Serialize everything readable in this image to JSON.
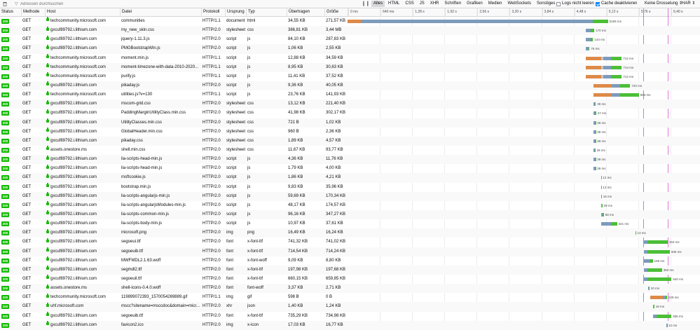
{
  "toolbar": {
    "filter_placeholder": "Adressen durchsuchen",
    "pause_glyph": "❙❙",
    "types": [
      "Alles",
      "HTML",
      "CSS",
      "JS",
      "XHR",
      "Schriften",
      "Grafiken",
      "Medien",
      "WebSockets",
      "Sonstiges"
    ],
    "active_type": "Alles",
    "persist_logs_label": "Logs nicht leeren",
    "persist_logs_checked": false,
    "disable_cache_label": "Cache deaktivieren",
    "disable_cache_checked": true,
    "throttle_label": "Keine Drosselung ⇕",
    "har_label": "HAR ⇕"
  },
  "columns": {
    "status": "Status",
    "method": "Methode",
    "host": "Host",
    "file": "Datei",
    "protocol": "Protokoll",
    "cause": "Ursprung",
    "type": "Typ",
    "transferred": "Übertragen",
    "size": "Größe"
  },
  "timeline_ticks": [
    "0 ms",
    "640 ms",
    "1,28 s",
    "1,92 s",
    "2,56 s",
    "3,20 s",
    "3,84 s",
    "4,48 s",
    "5,12 s",
    "5,76 s",
    "6,40 s"
  ],
  "timeline_max_ms": 6984,
  "markers": {
    "dom_content_loaded_ms": 5860,
    "load_ms": 6340
  },
  "colors": {
    "blocked": "#dd8a48",
    "connect": "#c4c4c7",
    "wait": "#7d9bbb",
    "receive": "#4bbf36",
    "status_ok": "#12bc00"
  },
  "requests": [
    {
      "status": "200",
      "method": "GET",
      "host": "techcommunity.microsoft.com",
      "file": "communities",
      "protocol": "HTTP/1.1",
      "cause": "document",
      "type": "html",
      "transferred": "34,55 KB",
      "size": "271,57 KB",
      "start": 0,
      "blocked": 260,
      "connect": 0,
      "wait": 4600,
      "recv": 300,
      "label": "5156 ms"
    },
    {
      "status": "200",
      "method": "GET",
      "host": "gxcuf89792.i.lithium.com",
      "file": "my_new_skin.css",
      "protocol": "HTTP/2.0",
      "cause": "stylesheet",
      "type": "css",
      "transferred": "386,81 KB",
      "size": "3,44 MB",
      "start": 4720,
      "blocked": 0,
      "connect": 0,
      "wait": 100,
      "recv": 70,
      "label": "170 ms"
    },
    {
      "status": "200",
      "method": "GET",
      "host": "gxcuf89792.i.lithium.com",
      "file": "jquery-1.11.3.js",
      "protocol": "HTTP/2.0",
      "cause": "script",
      "type": "js",
      "transferred": "84,10 KB",
      "size": "287,83 KB",
      "start": 4720,
      "blocked": 0,
      "connect": 0,
      "wait": 100,
      "recv": 44,
      "label": "144 ms"
    },
    {
      "status": "200",
      "method": "GET",
      "host": "gxcuf89792.i.lithium.com",
      "file": "PMGBootstrapWin.js",
      "protocol": "HTTP/2.0",
      "cause": "script",
      "type": "js",
      "transferred": "1,06 KB",
      "size": "2,55 KB",
      "start": 4720,
      "blocked": 0,
      "connect": 0,
      "wait": 60,
      "recv": 16,
      "label": "76 ms"
    },
    {
      "status": "200",
      "method": "GET",
      "host": "techcommunity.microsoft.com",
      "file": "moment.min.js",
      "protocol": "HTTP/1.1",
      "cause": "script",
      "type": "js",
      "transferred": "12,88 KB",
      "size": "34,59 KB",
      "start": 4720,
      "blocked": 300,
      "connect": 50,
      "wait": 150,
      "recv": 212,
      "label": "712 ms"
    },
    {
      "status": "200",
      "method": "GET",
      "host": "techcommunity.microsoft.com",
      "file": "moment-timezone-with-data-2010-2020...",
      "protocol": "HTTP/1.1",
      "cause": "script",
      "type": "js",
      "transferred": "8,95 KB",
      "size": "30,63 KB",
      "start": 4720,
      "blocked": 300,
      "connect": 50,
      "wait": 150,
      "recv": 214,
      "label": "714 ms"
    },
    {
      "status": "200",
      "method": "GET",
      "host": "techcommunity.microsoft.com",
      "file": "purify.js",
      "protocol": "HTTP/1.1",
      "cause": "script",
      "type": "js",
      "transferred": "11,41 KB",
      "size": "37,52 KB",
      "start": 4720,
      "blocked": 300,
      "connect": 50,
      "wait": 150,
      "recv": 213,
      "label": "713 ms"
    },
    {
      "status": "200",
      "method": "GET",
      "host": "gxcuf89792.i.lithium.com",
      "file": "pikaday.js",
      "protocol": "HTTP/2.0",
      "cause": "script",
      "type": "js",
      "transferred": "9,36 KB",
      "size": "40,05 KB",
      "start": 4880,
      "blocked": 360,
      "connect": 0,
      "wait": 160,
      "recv": 200,
      "label": "720 ms"
    },
    {
      "status": "200",
      "method": "GET",
      "host": "techcommunity.microsoft.com",
      "file": "utilities.js?v=130",
      "protocol": "HTTP/1.1",
      "cause": "script",
      "type": "js",
      "transferred": "23,76 KB",
      "size": "141,93 KB",
      "start": 4880,
      "blocked": 360,
      "connect": 0,
      "wait": 160,
      "recv": 373,
      "label": "893 ms"
    },
    {
      "status": "200",
      "method": "GET",
      "host": "gxcuf89792.i.lithium.com",
      "file": "mscom-grid.css",
      "protocol": "HTTP/2.0",
      "cause": "stylesheet",
      "type": "css",
      "transferred": "13,12 KB",
      "size": "221,40 KB",
      "start": 4880,
      "blocked": 0,
      "connect": 0,
      "wait": 20,
      "recv": 19,
      "label": "39 ms"
    },
    {
      "status": "200",
      "method": "GET",
      "host": "gxcuf89792.i.lithium.com",
      "file": "PaddingMarginUtilityClass.min.css",
      "protocol": "HTTP/2.0",
      "cause": "stylesheet",
      "type": "css",
      "transferred": "41,98 KB",
      "size": "302,17 KB",
      "start": 4880,
      "blocked": 0,
      "connect": 0,
      "wait": 25,
      "recv": 22,
      "label": "47 ms"
    },
    {
      "status": "200",
      "method": "GET",
      "host": "gxcuf89792.i.lithium.com",
      "file": "UtilityClasses.min.css",
      "protocol": "HTTP/2.0",
      "cause": "stylesheet",
      "type": "css",
      "transferred": "721 B",
      "size": "1,02 KB",
      "start": 4880,
      "blocked": 0,
      "connect": 0,
      "wait": 30,
      "recv": 9,
      "label": "39 ms"
    },
    {
      "status": "200",
      "method": "GET",
      "host": "gxcuf89792.i.lithium.com",
      "file": "GlobalHeader.min.css",
      "protocol": "HTTP/2.0",
      "cause": "stylesheet",
      "type": "css",
      "transferred": "960 B",
      "size": "2,36 KB",
      "start": 4880,
      "blocked": 0,
      "connect": 0,
      "wait": 30,
      "recv": 9,
      "label": "39 ms"
    },
    {
      "status": "200",
      "method": "GET",
      "host": "gxcuf89792.i.lithium.com",
      "file": "pikaday.css",
      "protocol": "HTTP/2.0",
      "cause": "stylesheet",
      "type": "css",
      "transferred": "1,89 KB",
      "size": "4,57 KB",
      "start": 4880,
      "blocked": 0,
      "connect": 0,
      "wait": 30,
      "recv": 9,
      "label": "39 ms"
    },
    {
      "status": "200",
      "method": "GET",
      "host": "assets.onestore.ms",
      "file": "shell.min.css",
      "protocol": "HTTP/2.0",
      "cause": "stylesheet",
      "type": "css",
      "transferred": "11,67 KB",
      "size": "93,77 KB",
      "start": 4880,
      "blocked": 0,
      "connect": 0,
      "wait": 20,
      "recv": 8,
      "label": "28 ms"
    },
    {
      "status": "200",
      "method": "GET",
      "host": "gxcuf89792.i.lithium.com",
      "file": "lia-scripts-head-min.js",
      "protocol": "HTTP/2.0",
      "cause": "script",
      "type": "js",
      "transferred": "4,36 KB",
      "size": "11,76 KB",
      "start": 4880,
      "blocked": 0,
      "connect": 0,
      "wait": 30,
      "recv": 9,
      "label": "39 ms"
    },
    {
      "status": "200",
      "method": "GET",
      "host": "gxcuf89792.i.lithium.com",
      "file": "lia-scripts-head-min.js",
      "protocol": "HTTP/2.0",
      "cause": "script",
      "type": "js",
      "transferred": "1,79 KB",
      "size": "4,00 KB",
      "start": 4880,
      "blocked": 0,
      "connect": 0,
      "wait": 30,
      "recv": 9,
      "label": "39 ms"
    },
    {
      "status": "200",
      "method": "GET",
      "host": "gxcuf89792.i.lithium.com",
      "file": "msftcookie.js",
      "protocol": "HTTP/2.0",
      "cause": "script",
      "type": "js",
      "transferred": "1,86 KB",
      "size": "4,21 KB",
      "start": 5020,
      "blocked": 0,
      "connect": 0,
      "wait": 8,
      "recv": 4,
      "label": "12 ms"
    },
    {
      "status": "200",
      "method": "GET",
      "host": "gxcuf89792.i.lithium.com",
      "file": "bootstrap.min.js",
      "protocol": "HTTP/2.0",
      "cause": "script",
      "type": "js",
      "transferred": "9,83 KB",
      "size": "35,96 KB",
      "start": 5020,
      "blocked": 0,
      "connect": 0,
      "wait": 8,
      "recv": 4,
      "label": "12 ms"
    },
    {
      "status": "200",
      "method": "GET",
      "host": "gxcuf89792.i.lithium.com",
      "file": "lia-scripts-angularjs-min.js",
      "protocol": "HTTP/2.0",
      "cause": "script",
      "type": "js",
      "transferred": "59,69 KB",
      "size": "170,34 KB",
      "start": 5020,
      "blocked": 0,
      "connect": 0,
      "wait": 10,
      "recv": 6,
      "label": "16 ms"
    },
    {
      "status": "200",
      "method": "GET",
      "host": "gxcuf89792.i.lithium.com",
      "file": "lia-scripts-angularjsModules-min.js",
      "protocol": "HTTP/2.0",
      "cause": "script",
      "type": "js",
      "transferred": "48,17 KB",
      "size": "174,57 KB",
      "start": 5020,
      "blocked": 0,
      "connect": 0,
      "wait": 14,
      "recv": 15,
      "label": "29 ms"
    },
    {
      "status": "200",
      "method": "GET",
      "host": "gxcuf89792.i.lithium.com",
      "file": "lia-scripts-common-min.js",
      "protocol": "HTTP/2.0",
      "cause": "script",
      "type": "js",
      "transferred": "96,16 KB",
      "size": "347,27 KB",
      "start": 5020,
      "blocked": 0,
      "connect": 0,
      "wait": 28,
      "recv": 30,
      "label": "58 ms"
    },
    {
      "status": "200",
      "method": "GET",
      "host": "gxcuf89792.i.lithium.com",
      "file": "lia-scripts-body-min.js",
      "protocol": "HTTP/2.0",
      "cause": "script",
      "type": "js",
      "transferred": "10,97 KB",
      "size": "37,61 KB",
      "start": 5020,
      "blocked": 0,
      "connect": 0,
      "wait": 200,
      "recv": 121,
      "label": "321 ms"
    },
    {
      "status": "200",
      "method": "GET",
      "host": "gxcuf89792.i.lithium.com",
      "file": "microsoft.png",
      "protocol": "HTTP/2.0",
      "cause": "img",
      "type": "png",
      "transferred": "16,49 KB",
      "size": "16,24 KB",
      "start": 5700,
      "blocked": 0,
      "connect": 0,
      "wait": 9,
      "recv": 4,
      "label": "13 ms"
    },
    {
      "status": "200",
      "method": "GET",
      "host": "gxcuf89792.i.lithium.com",
      "file": "segoeui.ttf",
      "protocol": "HTTP/2.0",
      "cause": "font",
      "type": "x-font-ttf",
      "transferred": "741,32 KB",
      "size": "741,02 KB",
      "start": 5880,
      "blocked": 0,
      "connect": 0,
      "wait": 60,
      "recv": 403,
      "label": "463 ms"
    },
    {
      "status": "200",
      "method": "GET",
      "host": "gxcuf89792.i.lithium.com",
      "file": "segoeuib.ttf",
      "protocol": "HTTP/2.0",
      "cause": "font",
      "type": "x-font-ttf",
      "transferred": "714,54 KB",
      "size": "714,24 KB",
      "start": 5880,
      "blocked": 0,
      "connect": 0,
      "wait": 60,
      "recv": 446,
      "label": "506 ms"
    },
    {
      "status": "200",
      "method": "GET",
      "host": "gxcuf89792.i.lithium.com",
      "file": "MWFMDL2.1.63.woff",
      "protocol": "HTTP/2.0",
      "cause": "font",
      "type": "x-font-woff",
      "transferred": "9,09 KB",
      "size": "8,80 KB",
      "start": 5880,
      "blocked": 0,
      "connect": 0,
      "wait": 100,
      "recv": 69,
      "label": "169 ms"
    },
    {
      "status": "200",
      "method": "GET",
      "host": "gxcuf89792.i.lithium.com",
      "file": "segmdl2.ttf",
      "protocol": "HTTP/2.0",
      "cause": "font",
      "type": "x-font-ttf",
      "transferred": "197,98 KB",
      "size": "197,68 KB",
      "start": 5880,
      "blocked": 0,
      "connect": 0,
      "wait": 60,
      "recv": 290,
      "label": "350 ms"
    },
    {
      "status": "200",
      "method": "GET",
      "host": "gxcuf89792.i.lithium.com",
      "file": "segoeuil.ttf",
      "protocol": "HTTP/2.0",
      "cause": "font",
      "type": "x-font-ttf",
      "transferred": "660,15 KB",
      "size": "659,85 KB",
      "start": 5880,
      "blocked": 0,
      "connect": 0,
      "wait": 60,
      "recv": 480,
      "label": "540 ms"
    },
    {
      "status": "200",
      "method": "GET",
      "host": "assets.onestore.ms",
      "file": "shell-icons-0.4.0.woff",
      "protocol": "HTTP/2.0",
      "cause": "font",
      "type": "font-woff",
      "transferred": "3,37 KB",
      "size": "2,71 KB",
      "start": 5960,
      "blocked": 0,
      "connect": 0,
      "wait": 14,
      "recv": 6,
      "label": "20 ms"
    },
    {
      "status": "200",
      "method": "GET",
      "host": "techcommunity.microsoft.com",
      "file": "119899072393_1570054269889.gif",
      "protocol": "HTTP/1.1",
      "cause": "img",
      "type": "gif",
      "transferred": "598 B",
      "size": "0 B",
      "start": 6000,
      "blocked": 250,
      "connect": 0,
      "wait": 50,
      "recv": 29,
      "label": "329 ms"
    },
    {
      "status": "200",
      "method": "GET",
      "host": "uhf.microsoft.com",
      "file": "mscc?sitename=msccdoc&domain=micr...",
      "protocol": "HTTP/2.0",
      "cause": "xhr",
      "type": "json",
      "transferred": "1,40 KB",
      "size": "1,24 KB",
      "start": 6060,
      "blocked": 0,
      "connect": 0,
      "wait": 12,
      "recv": 6,
      "label": "18 ms"
    },
    {
      "status": "200",
      "method": "GET",
      "host": "gxcuf89792.i.lithium.com",
      "file": "segoeuib.ttf",
      "protocol": "HTTP/2.0",
      "cause": "font",
      "type": "x-font-ttf",
      "transferred": "735,29 KB",
      "size": "734,98 KB",
      "start": 6060,
      "blocked": 0,
      "connect": 0,
      "wait": 60,
      "recv": 296,
      "label": "356 ms"
    },
    {
      "status": "200",
      "method": "GET",
      "host": "gxcuf89792.i.lithium.com",
      "file": "favicon2.ico",
      "protocol": "HTTP/2.0",
      "cause": "img",
      "type": "x-icon",
      "transferred": "17,03 KB",
      "size": "16,77 KB",
      "start": 6320,
      "blocked": 0,
      "connect": 0,
      "wait": 8,
      "recv": 4,
      "label": "12 ms"
    }
  ]
}
